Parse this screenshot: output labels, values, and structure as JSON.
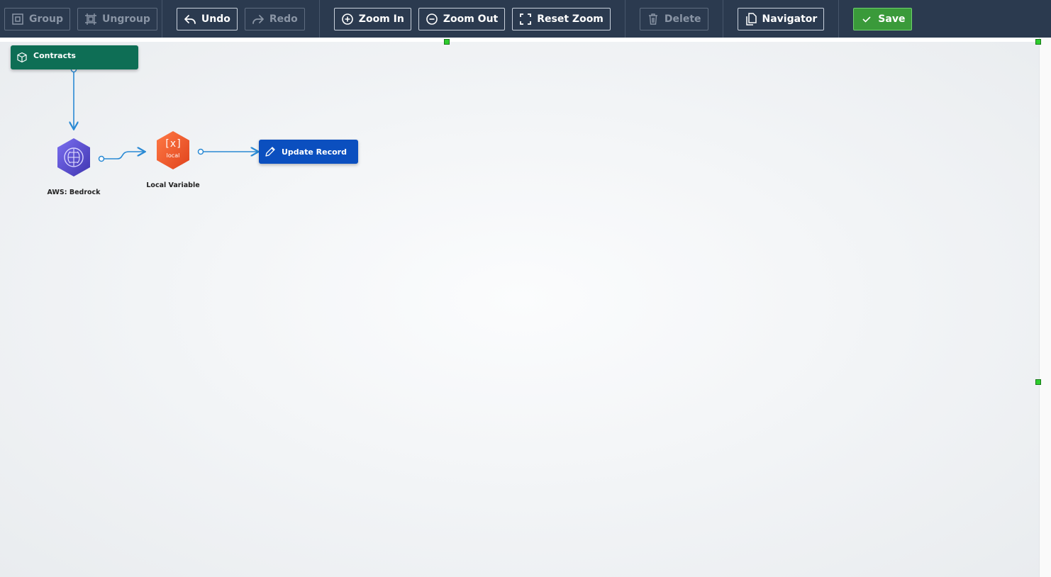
{
  "toolbar": {
    "group_label": "Group",
    "ungroup_label": "Ungroup",
    "undo_label": "Undo",
    "redo_label": "Redo",
    "zoom_in_label": "Zoom In",
    "zoom_out_label": "Zoom Out",
    "reset_zoom_label": "Reset Zoom",
    "delete_label": "Delete",
    "navigator_label": "Navigator",
    "save_label": "Save"
  },
  "canvas": {
    "nodes": {
      "contracts": {
        "label": "Contracts",
        "icon": "cube-icon",
        "color": "#0e6e55"
      },
      "bedrock": {
        "label": "AWS: Bedrock",
        "icon": "brain-icon",
        "color": "#5a4fcf"
      },
      "local_variable": {
        "label": "Local Variable",
        "icon": "variable-icon",
        "icon_text": "[x]",
        "icon_subtext": "local",
        "color": "#f05a28"
      },
      "update_record": {
        "label": "Update Record",
        "icon": "pencil-icon",
        "color": "#0b4fbf"
      }
    }
  },
  "colors": {
    "toolbar_bg": "#2b3a4f",
    "connector": "#2a8ad4",
    "save_bg": "#3a9a3a"
  }
}
